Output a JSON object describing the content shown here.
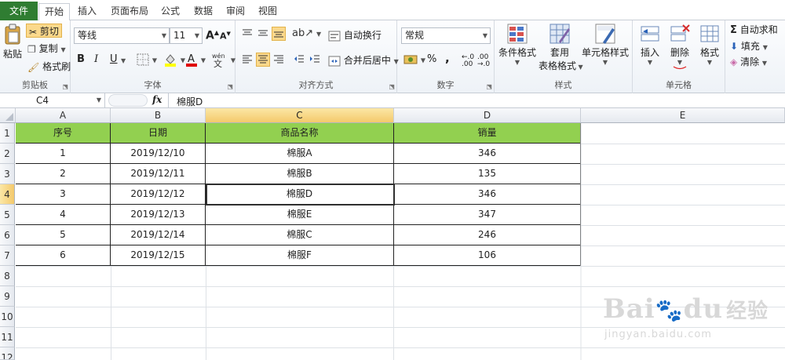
{
  "tabs": [
    {
      "label": "文件",
      "key": "file"
    },
    {
      "label": "开始",
      "key": "home",
      "active": true
    },
    {
      "label": "插入",
      "key": "insert"
    },
    {
      "label": "页面布局",
      "key": "layout"
    },
    {
      "label": "公式",
      "key": "formulas"
    },
    {
      "label": "数据",
      "key": "data"
    },
    {
      "label": "审阅",
      "key": "review"
    },
    {
      "label": "视图",
      "key": "view"
    }
  ],
  "ribbon": {
    "clipboard": {
      "paste": "粘贴",
      "cut": "剪切",
      "copy": "复制",
      "format_painter": "格式刷",
      "label": "剪贴板"
    },
    "font": {
      "name": "等线",
      "size": "11",
      "bold": "B",
      "italic": "I",
      "underline": "U",
      "grow": "A",
      "shrink": "A",
      "label": "字体"
    },
    "alignment": {
      "wrap": "自动换行",
      "merge": "合并后居中",
      "label": "对齐方式"
    },
    "number": {
      "format": "常规",
      "percent": "%",
      "comma": ",",
      "label": "数字"
    },
    "styles": {
      "conditional": "条件格式",
      "table_a": "套用",
      "table_b": "表格格式",
      "cell_styles": "单元格样式",
      "label": "样式"
    },
    "cells": {
      "insert": "插入",
      "delete": "删除",
      "format": "格式",
      "label": "单元格"
    },
    "editing": {
      "autosum": "自动求和",
      "fill": "填充",
      "clear": "清除"
    }
  },
  "formula_bar": {
    "name_box": "C4",
    "fx": "fx",
    "content": "棉服D"
  },
  "columns": [
    "A",
    "B",
    "C",
    "D",
    "E"
  ],
  "rows": [
    "1",
    "2",
    "3",
    "4",
    "5",
    "6",
    "7",
    "8",
    "9",
    "10",
    "11",
    "12"
  ],
  "table": {
    "headers": [
      "序号",
      "日期",
      "商品名称",
      "销量"
    ],
    "rows": [
      [
        "1",
        "2019/12/10",
        "棉服A",
        "346"
      ],
      [
        "2",
        "2019/12/11",
        "棉服B",
        "135"
      ],
      [
        "3",
        "2019/12/12",
        "棉服D",
        "346"
      ],
      [
        "4",
        "2019/12/13",
        "棉服E",
        "347"
      ],
      [
        "5",
        "2019/12/14",
        "棉服C",
        "246"
      ],
      [
        "6",
        "2019/12/15",
        "棉服F",
        "106"
      ]
    ]
  },
  "selected_cell": "C4",
  "watermark": {
    "brand": "Bai",
    "brand2": "du",
    "cn": "经验",
    "url": "jingyan.baidu.com"
  },
  "colors": {
    "header_fill": "#92d050",
    "file_tab": "#2f7d32",
    "selection": "#fbd98c"
  }
}
